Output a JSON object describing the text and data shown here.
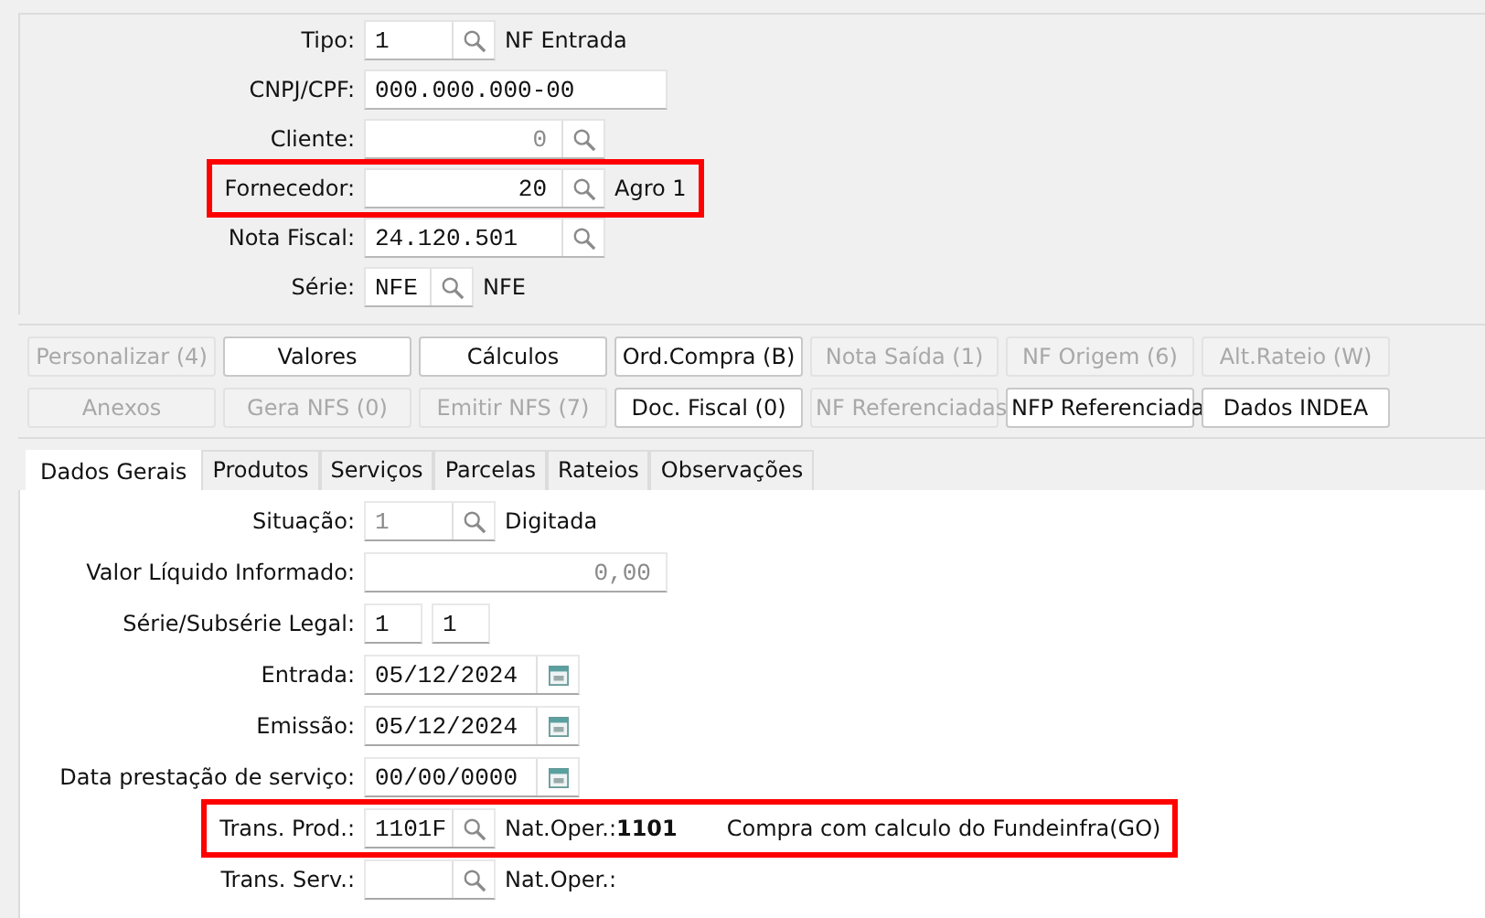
{
  "header_fields": [
    {
      "label": "Tipo:",
      "kind": "short-lookup",
      "value": "1",
      "disabled": false,
      "description": "NF Entrada",
      "highlighted": false
    },
    {
      "label": "CNPJ/CPF:",
      "kind": "text",
      "value": "000.000.000-00",
      "disabled": false,
      "highlighted": false
    },
    {
      "label": "Cliente:",
      "kind": "number-lookup",
      "value": "0",
      "disabled": true,
      "highlighted": false
    },
    {
      "label": "Fornecedor:",
      "kind": "number-lookup",
      "value": "20",
      "disabled": false,
      "description": "Agro 1",
      "highlighted": true
    },
    {
      "label": "Nota Fiscal:",
      "kind": "lookup",
      "value": "24.120.501",
      "disabled": false,
      "highlighted": false
    },
    {
      "label": "Série:",
      "kind": "series-lookup",
      "value": "NFE",
      "disabled": false,
      "description": "NFE",
      "highlighted": false
    }
  ],
  "buttons": [
    {
      "label": "Personalizar (4)",
      "disabled": true
    },
    {
      "label": "Valores",
      "disabled": false
    },
    {
      "label": "Cálculos",
      "disabled": false
    },
    {
      "label": "Ord.Compra (B)",
      "disabled": false
    },
    {
      "label": "Nota Saída (1)",
      "disabled": true
    },
    {
      "label": "NF Origem (6)",
      "disabled": true
    },
    {
      "label": "Alt.Rateio (W)",
      "disabled": true
    },
    {
      "label": "Anexos",
      "disabled": true
    },
    {
      "label": "Gera NFS (0)",
      "disabled": true
    },
    {
      "label": "Emitir NFS (7)",
      "disabled": true
    },
    {
      "label": "Doc. Fiscal (0)",
      "disabled": false
    },
    {
      "label": "NF Referenciadas",
      "disabled": true
    },
    {
      "label": "NFP Referenciada",
      "disabled": false
    },
    {
      "label": "Dados INDEA",
      "disabled": false
    }
  ],
  "tabs": [
    {
      "label": "Dados Gerais",
      "selected": true
    },
    {
      "label": "Produtos",
      "selected": false
    },
    {
      "label": "Serviços",
      "selected": false
    },
    {
      "label": "Parcelas",
      "selected": false
    },
    {
      "label": "Rateios",
      "selected": false
    },
    {
      "label": "Observações",
      "selected": false
    }
  ],
  "form_fields": [
    {
      "label": "Situação:",
      "kind": "short-lookup",
      "value": "1",
      "disabled": true,
      "description": "Digitada",
      "highlighted": false
    },
    {
      "label": "Valor Líquido Informado:",
      "kind": "number",
      "value": "0,00",
      "disabled": true,
      "highlighted": false
    },
    {
      "label": "Série/Subsérie Legal:",
      "kind": "pair",
      "values": [
        "1",
        "1"
      ],
      "highlighted": false
    },
    {
      "label": "Entrada:",
      "kind": "date",
      "value": "05/12/2024",
      "highlighted": false
    },
    {
      "label": "Emissão:",
      "kind": "date",
      "value": "05/12/2024",
      "highlighted": false
    },
    {
      "label": "Data prestação de serviço:",
      "kind": "date",
      "value": "00/00/0000",
      "highlighted": false
    },
    {
      "label": "Trans. Prod.:",
      "kind": "short-lookup",
      "value": "1101F",
      "disabled": false,
      "nat_oper": "Nat.Oper.:**1101**",
      "description": "Compra com calculo do Fundeinfra(GO)",
      "highlighted": true
    },
    {
      "label": "Trans. Serv.:",
      "kind": "short-lookup",
      "nat_oper": "Nat.Oper.:",
      "highlighted": false
    }
  ]
}
